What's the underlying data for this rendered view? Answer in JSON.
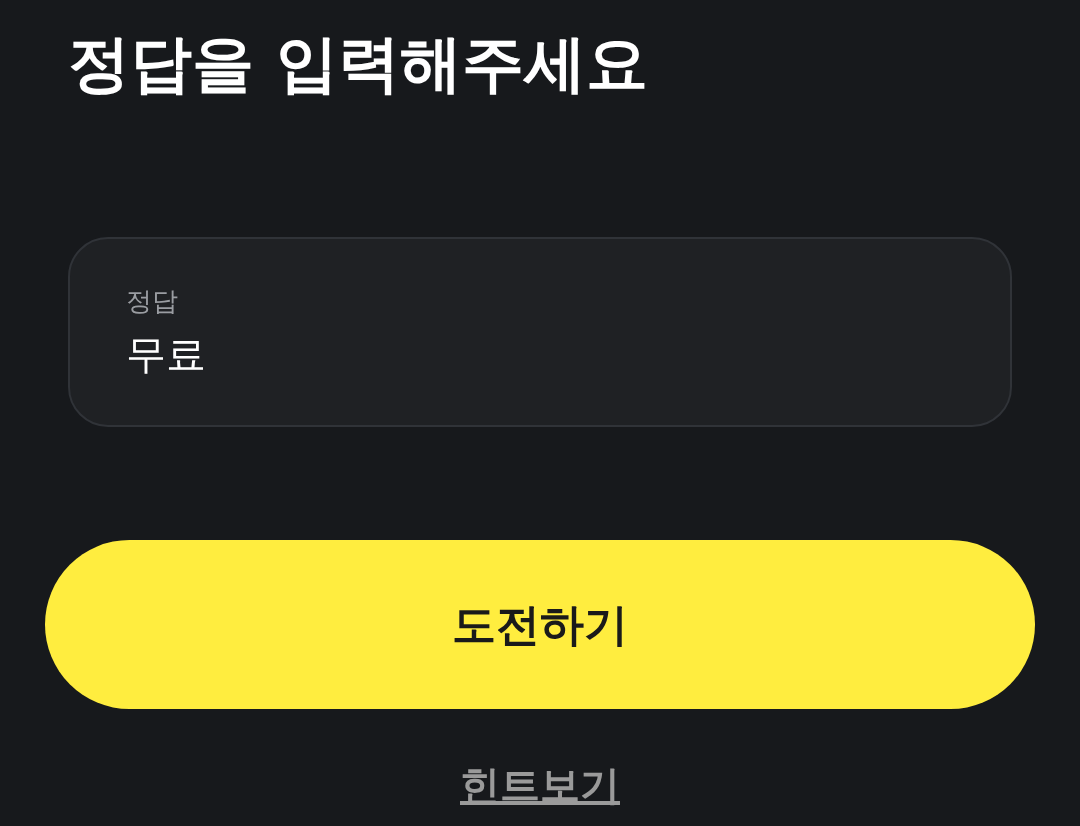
{
  "title": "정답을 입력해주세요",
  "answer_field": {
    "label": "정답",
    "value": "무료"
  },
  "submit_button": {
    "label": "도전하기"
  },
  "hint_link": {
    "label": "힌트보기"
  }
}
